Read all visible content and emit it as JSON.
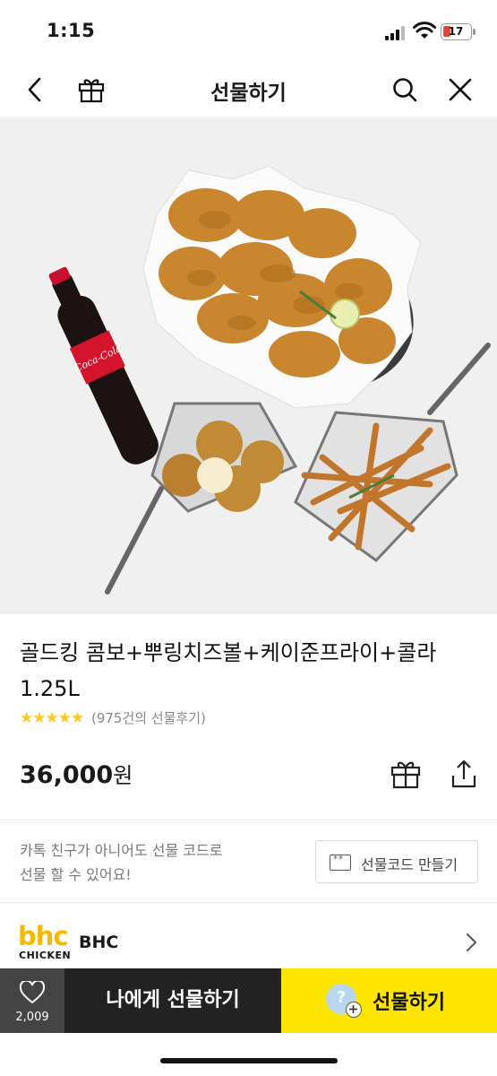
{
  "status_bar": {
    "time": "1:15",
    "battery": "17"
  },
  "header": {
    "title": "선물하기"
  },
  "product": {
    "title": "골드킹 콤보+뿌링치즈볼+케이준프라이+콜라 1.25L",
    "stars": "★★★★★",
    "review_text": "(975건의 선물후기)",
    "price": "36,000",
    "price_unit": "원",
    "image_text": "Coca-Cola"
  },
  "gift_code": {
    "info_line1": "카톡 친구가 아니어도 선물 코드로",
    "info_line2": "선물 할 수 있어요!",
    "button_label": "선물코드 만들기",
    "ticket_glyph": "**"
  },
  "brand": {
    "logo_text": "bhc",
    "logo_sub": "CHICKEN",
    "name": "BHC"
  },
  "bottom_bar": {
    "like_count": "2,009",
    "self_gift_label": "나에게 선물하기",
    "gift_label": "선물하기",
    "avatar_glyph": "?"
  },
  "colors": {
    "accent": "#fee500",
    "dark": "#222222",
    "star": "#ffc81e",
    "brand": "#f5b800"
  }
}
